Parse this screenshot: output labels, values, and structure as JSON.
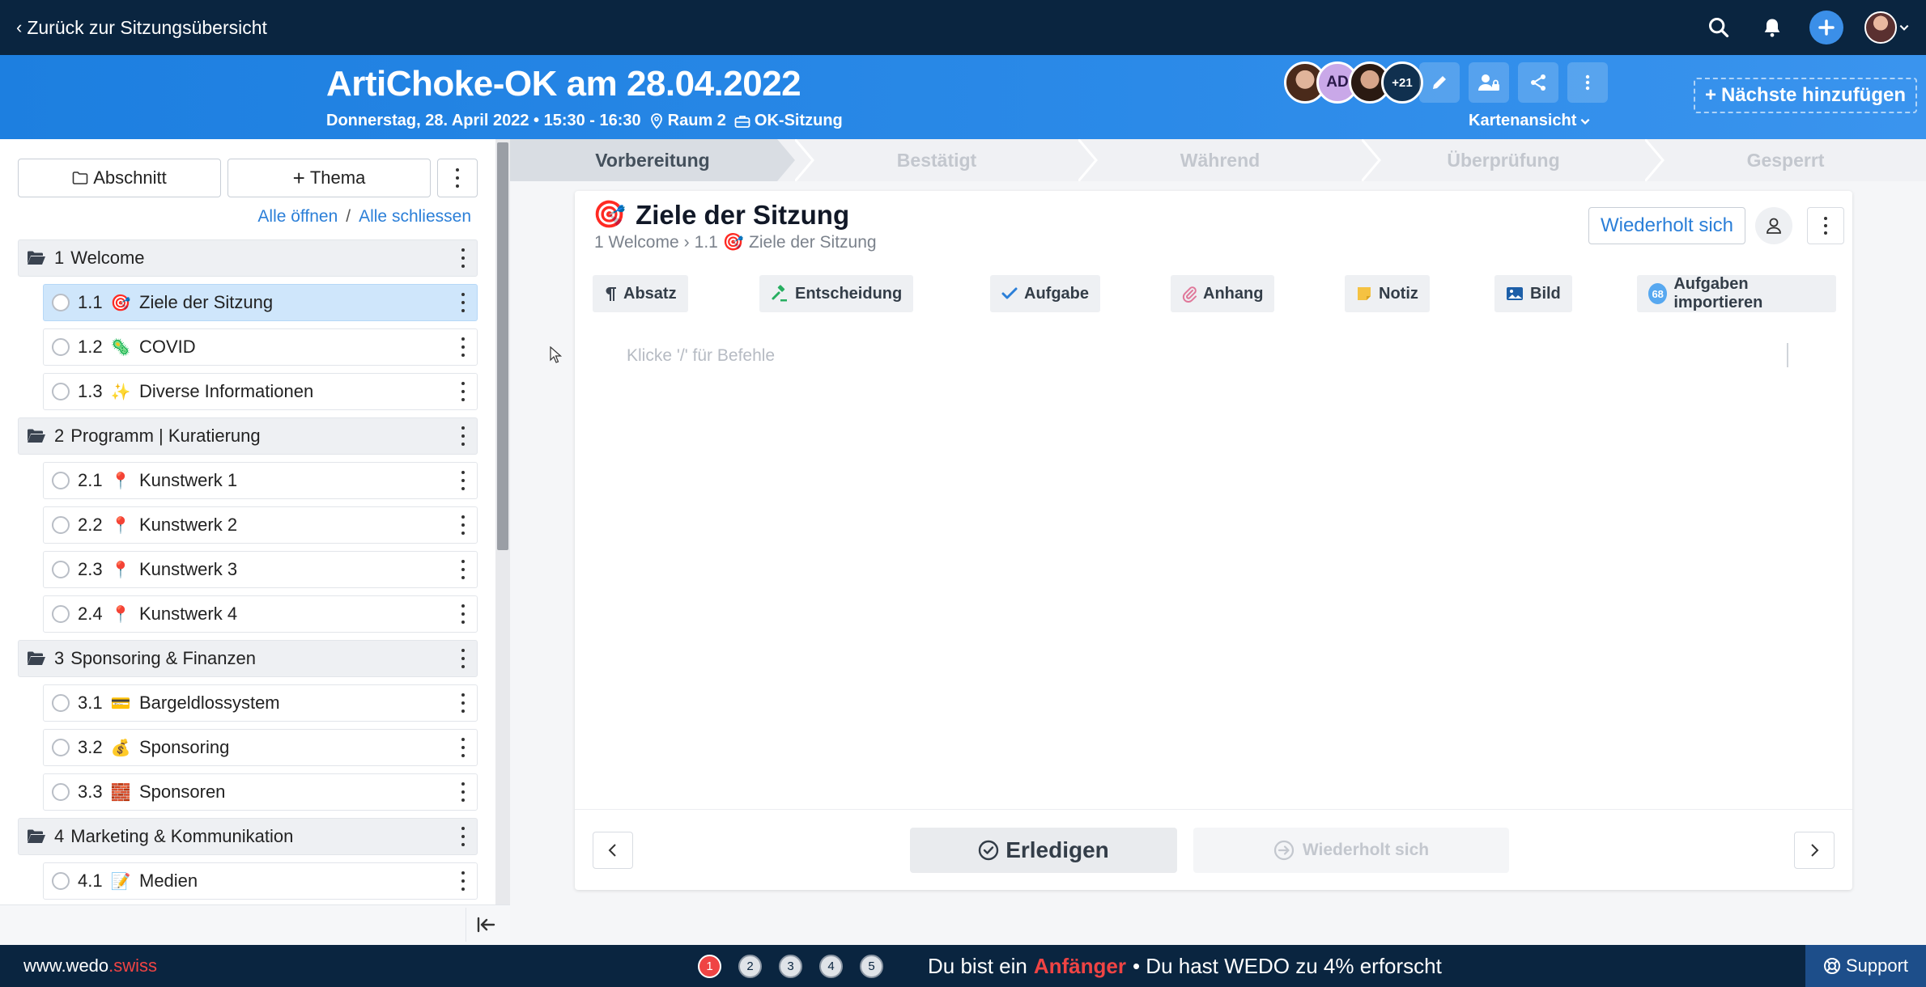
{
  "topbar": {
    "back_label": "Zurück zur Sitzungsübersicht"
  },
  "header": {
    "title": "ArtiChoke-OK am 28.04.2022",
    "date_time": "Donnerstag, 28. April 2022 • 15:30 - 16:30",
    "room": "Raum 2",
    "meeting_type": "OK-Sitzung",
    "participants": [
      {
        "initials": ""
      },
      {
        "initials": "AD"
      },
      {
        "initials": ""
      },
      {
        "initials": "+21"
      }
    ],
    "view_label": "Kartenansicht",
    "add_next_label": "Nächste hinzufügen"
  },
  "sidebar": {
    "section_button": "Abschnitt",
    "topic_button": "Thema",
    "open_all": "Alle öffnen",
    "separator": "/",
    "close_all": "Alle schliessen",
    "agenda": [
      {
        "type": "section",
        "num": "1",
        "title": "Welcome"
      },
      {
        "type": "topic",
        "num": "1.1",
        "emoji": "🎯",
        "title": "Ziele der Sitzung",
        "active": true
      },
      {
        "type": "topic",
        "num": "1.2",
        "emoji": "🦠",
        "title": "COVID"
      },
      {
        "type": "topic",
        "num": "1.3",
        "emoji": "✨",
        "title": "Diverse Informationen"
      },
      {
        "type": "section",
        "num": "2",
        "title": "Programm | Kuratierung"
      },
      {
        "type": "topic",
        "num": "2.1",
        "emoji": "📍",
        "title": "Kunstwerk 1"
      },
      {
        "type": "topic",
        "num": "2.2",
        "emoji": "📍",
        "title": "Kunstwerk 2"
      },
      {
        "type": "topic",
        "num": "2.3",
        "emoji": "📍",
        "title": "Kunstwerk 3"
      },
      {
        "type": "topic",
        "num": "2.4",
        "emoji": "📍",
        "title": "Kunstwerk 4"
      },
      {
        "type": "section",
        "num": "3",
        "title": "Sponsoring & Finanzen"
      },
      {
        "type": "topic",
        "num": "3.1",
        "emoji": "💳",
        "title": "Bargeldlossystem"
      },
      {
        "type": "topic",
        "num": "3.2",
        "emoji": "💰",
        "title": "Sponsoring"
      },
      {
        "type": "topic",
        "num": "3.3",
        "emoji": "🧱",
        "title": "Sponsoren"
      },
      {
        "type": "section",
        "num": "4",
        "title": "Marketing & Kommunikation"
      },
      {
        "type": "topic",
        "num": "4.1",
        "emoji": "📝",
        "title": "Medien"
      }
    ]
  },
  "stepper": [
    "Vorbereitung",
    "Bestätigt",
    "Während",
    "Überprüfung",
    "Gesperrt"
  ],
  "card": {
    "emoji": "🎯",
    "title": "Ziele der Sitzung",
    "breadcrumb_section": "1 Welcome",
    "breadcrumb_sep": "›",
    "breadcrumb_num": "1.1",
    "breadcrumb_emoji": "🎯",
    "breadcrumb_topic": "Ziele der Sitzung",
    "repeats_label": "Wiederholt sich",
    "blocks": {
      "absatz": "Absatz",
      "entscheidung": "Entscheidung",
      "aufgabe": "Aufgabe",
      "anhang": "Anhang",
      "notiz": "Notiz",
      "bild": "Bild",
      "import_badge": "68",
      "import": "Aufgaben importieren"
    },
    "editor_placeholder": "Klicke '/' für Befehle",
    "done_label": "Erledigen",
    "repeat_footer_label": "Wiederholt sich"
  },
  "bottombar": {
    "brand_main": "www.wedo",
    "brand_suffix": ".swiss",
    "steps": [
      "1",
      "2",
      "3",
      "4",
      "5"
    ],
    "level_prefix": "Du bist ein",
    "level": "Anfänger",
    "level_suffix": "• Du hast WEDO zu 4% erforscht",
    "support_label": "Support"
  },
  "colors": {
    "navy": "#0a2540",
    "header_blue": "#1d7fe0",
    "link_blue": "#2b7fd8",
    "active_topic": "#cfe6fb",
    "accent_red": "#ef4444"
  }
}
